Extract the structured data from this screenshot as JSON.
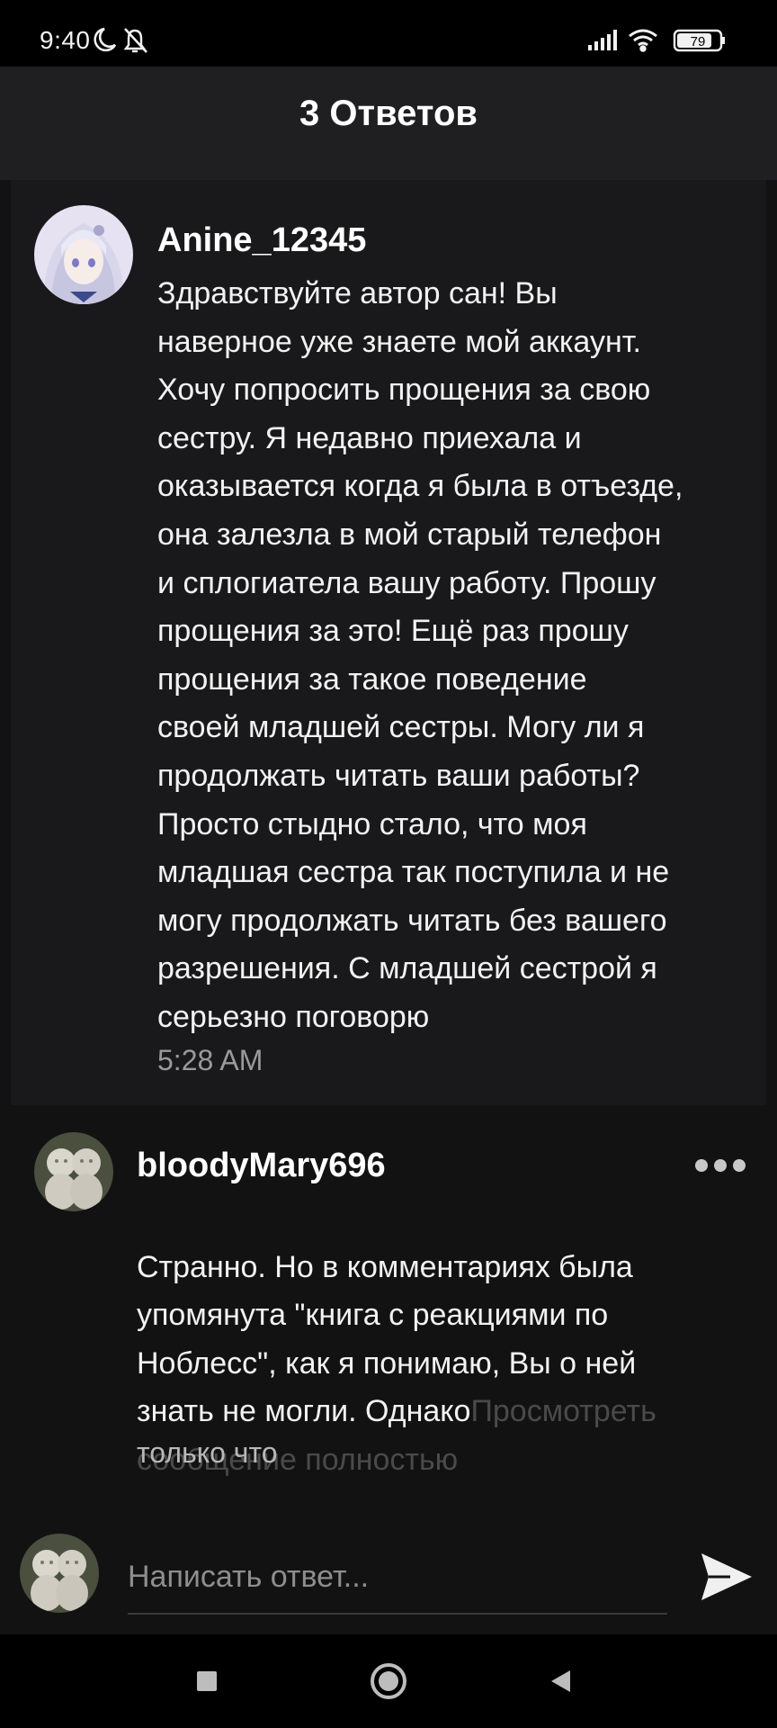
{
  "status_bar": {
    "time": "9:40",
    "battery": "79"
  },
  "header": {
    "title": "3 Ответов"
  },
  "parent_comment": {
    "username": "Anine_12345",
    "text": "Здравствуйте автор сан! Вы\nнаверное уже знаете мой аккаунт.\nХочу попросить прощения за свою\nсестру. Я недавно приехала и\nоказывается когда я была в отъезде,\nона залезла в мой старый телефон\nи сплогиатела вашу работу. Прошу\nпрощения за это! Ещё раз прошу\nпрощения за такое поведение\nсвоей младшей сестры. Могу ли я\nпродолжать читать ваши работы?\nПросто стыдно стало, что моя\nмладшая сестра так поступила и не\nмогу продолжать читать без вашего\nразрешения. С младшей сестрой я\nсерьезно поговорю",
    "time": "5:28 AM"
  },
  "reply": {
    "username": "bloodyMary696",
    "text": "Странно. Но в комментариях была\nупомянута \"книга с реакциями по\nНоблесс\", как я понимаю, Вы о ней\nзнать не могли. Однако",
    "view_full_line1": "Просмотреть",
    "view_full_line2": "сообщение полностью",
    "time": "только что"
  },
  "composer": {
    "placeholder": "Написать ответ..."
  },
  "icons": {
    "moon": "moon-icon",
    "bell_off": "bell-off-icon",
    "signal": "signal-icon",
    "wifi": "wifi-icon",
    "battery": "battery-icon",
    "more": "more-horizontal-icon",
    "send": "send-icon",
    "nav_recents": "square-icon",
    "nav_home": "circle-icon",
    "nav_back": "triangle-back-icon"
  },
  "colors": {
    "background": "#121212",
    "header": "#1f1f21",
    "parent_card": "#19191b",
    "muted_text": "#9a9a9a",
    "dim_link": "#4a4a4a"
  }
}
